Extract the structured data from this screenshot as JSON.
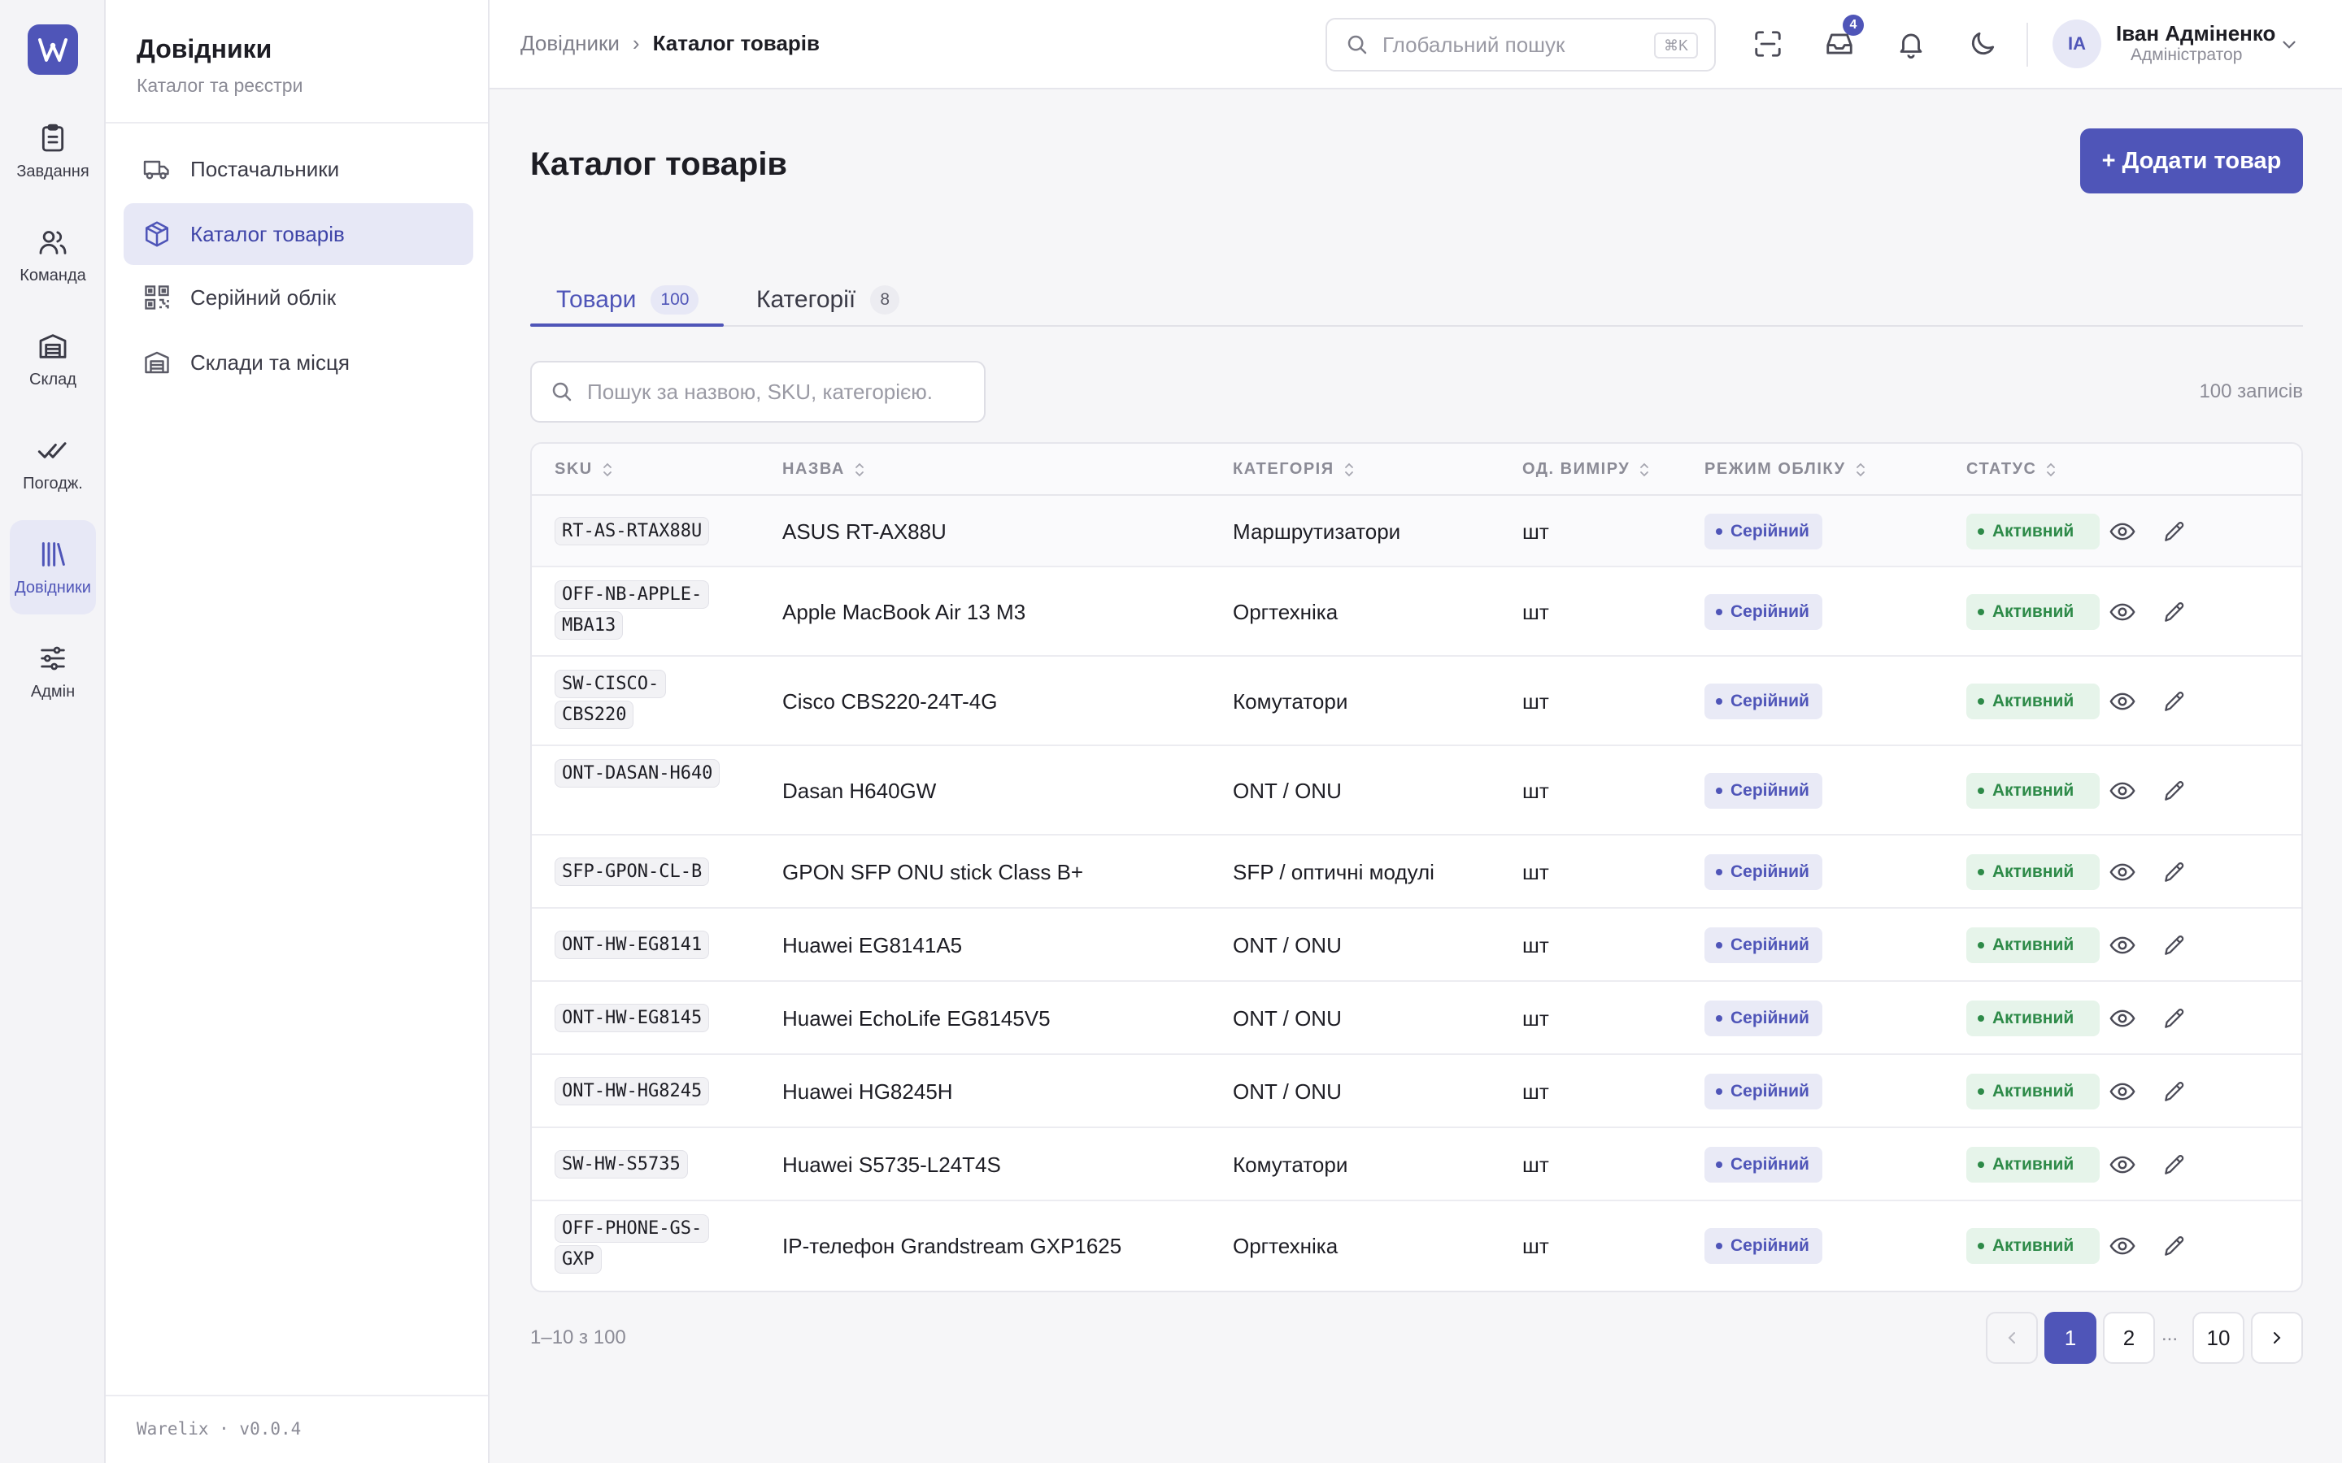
{
  "colors": {
    "accent": "#4f55b8",
    "success": "#2d8a48",
    "success_bg": "#e6f4ea",
    "accent_bg": "#e7e8f6"
  },
  "rail": {
    "logo": "W",
    "items": [
      {
        "label": "Завдання",
        "icon": "clipboard-icon"
      },
      {
        "label": "Команда",
        "icon": "users-icon"
      },
      {
        "label": "Склад",
        "icon": "warehouse-icon"
      },
      {
        "label": "Погодж.",
        "icon": "double-check-icon"
      },
      {
        "label": "Довідники",
        "icon": "library-icon",
        "active": true
      },
      {
        "label": "Адмін",
        "icon": "sliders-icon"
      }
    ]
  },
  "sidebar": {
    "title": "Довідники",
    "subtitle": "Каталог та реєстри",
    "items": [
      {
        "label": "Постачальники",
        "icon": "truck-icon"
      },
      {
        "label": "Каталог товарів",
        "icon": "box-icon",
        "active": true
      },
      {
        "label": "Серійний облік",
        "icon": "qr-code-icon"
      },
      {
        "label": "Склади та місця",
        "icon": "warehouse-icon"
      }
    ],
    "version": "Warelix · v0.0.4"
  },
  "topbar": {
    "breadcrumb_root": "Довідники",
    "breadcrumb_sep": "›",
    "breadcrumb_current": "Каталог товарів",
    "search_placeholder": "Глобальний пошук",
    "search_shortcut": "⌘K",
    "inbox_count": "4",
    "user_initials": "IA",
    "user_name": "Іван Адміненко",
    "user_role": "Адміністратор"
  },
  "main": {
    "title": "Каталог товарів",
    "add_button": "+ Додати товар",
    "tabs": [
      {
        "label": "Товари",
        "count": "100",
        "active": true
      },
      {
        "label": "Категорії",
        "count": "8"
      }
    ],
    "search_placeholder": "Пошук за назвою, SKU, категорією.",
    "records": "100 записів",
    "columns": [
      "SKU",
      "НАЗВА",
      "КАТЕГОРІЯ",
      "ОД. ВИМІРУ",
      "РЕЖИМ ОБЛІКУ",
      "СТАТУС"
    ],
    "rows": [
      {
        "sku": "RT-AS-RTAX88U",
        "name": "ASUS RT-AX88U",
        "category": "Маршрутизатори",
        "unit": "шт",
        "mode": "Серійний",
        "status": "Активний"
      },
      {
        "sku": "OFF-NB-APPLE-MBA13",
        "name": "Apple MacBook Air 13 M3",
        "category": "Оргтехніка",
        "unit": "шт",
        "mode": "Серійний",
        "status": "Активний"
      },
      {
        "sku": "SW-CISCO-CBS220",
        "name": "Cisco CBS220-24T-4G",
        "category": "Комутатори",
        "unit": "шт",
        "mode": "Серійний",
        "status": "Активний"
      },
      {
        "sku": "ONT-DASAN-H640",
        "name": "Dasan H640GW",
        "category": "ONT / ONU",
        "unit": "шт",
        "mode": "Серійний",
        "status": "Активний"
      },
      {
        "sku": "SFP-GPON-CL-B",
        "name": "GPON SFP ONU stick Class B+",
        "category": "SFP / оптичні модулі",
        "unit": "шт",
        "mode": "Серійний",
        "status": "Активний"
      },
      {
        "sku": "ONT-HW-EG8141",
        "name": "Huawei EG8141A5",
        "category": "ONT / ONU",
        "unit": "шт",
        "mode": "Серійний",
        "status": "Активний"
      },
      {
        "sku": "ONT-HW-EG8145",
        "name": "Huawei EchoLife EG8145V5",
        "category": "ONT / ONU",
        "unit": "шт",
        "mode": "Серійний",
        "status": "Активний"
      },
      {
        "sku": "ONT-HW-HG8245",
        "name": "Huawei HG8245H",
        "category": "ONT / ONU",
        "unit": "шт",
        "mode": "Серійний",
        "status": "Активний"
      },
      {
        "sku": "SW-HW-S5735",
        "name": "Huawei S5735-L24T4S",
        "category": "Комутатори",
        "unit": "шт",
        "mode": "Серійний",
        "status": "Активний"
      },
      {
        "sku": "OFF-PHONE-GS-GXP",
        "name": "IP-телефон Grandstream GXP1625",
        "category": "Оргтехніка",
        "unit": "шт",
        "mode": "Серійний",
        "status": "Активний"
      }
    ]
  },
  "pagination": {
    "range": "1–10 з 100",
    "pages": [
      "1",
      "2",
      "10"
    ],
    "current": "1",
    "ellipsis": "..."
  }
}
